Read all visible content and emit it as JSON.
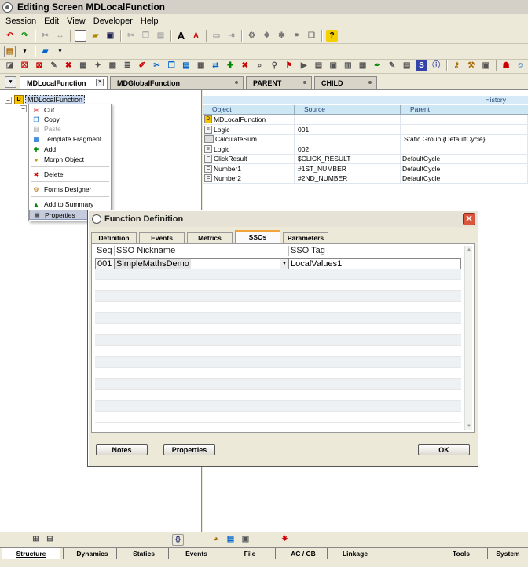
{
  "window": {
    "title": "Editing Screen MDLocalFunction"
  },
  "menu": [
    "Session",
    "Edit",
    "View",
    "Developer",
    "Help"
  ],
  "file_tabs": [
    "MDLocalFunction",
    "MDGlobalFunction",
    "PARENT",
    "CHILD"
  ],
  "tree": {
    "root": "MDLocalFunction"
  },
  "context_menu": {
    "cut": "Cut",
    "copy": "Copy",
    "paste": "Paste",
    "template_fragment": "Template Fragment",
    "add": "Add",
    "morph_object": "Morph Object",
    "delete": "Delete",
    "forms_designer": "Forms Designer",
    "add_to_summary": "Add to Summary",
    "properties": "Properties"
  },
  "grid": {
    "history": "History",
    "columns": [
      "Object",
      "Source",
      "Parent"
    ],
    "rows": [
      {
        "object": "MDLocalFunction",
        "source": "",
        "parent": ""
      },
      {
        "object": "Logic",
        "source": "001",
        "parent": ""
      },
      {
        "object": "CalculateSum",
        "source": "",
        "parent": "Static Group {DefaultCycle}"
      },
      {
        "object": "Logic",
        "source": "002",
        "parent": ""
      },
      {
        "object": "ClickResult",
        "source": "$CLICK_RESULT",
        "parent": "DefaultCycle"
      },
      {
        "object": "Number1",
        "source": "#1ST_NUMBER",
        "parent": "DefaultCycle"
      },
      {
        "object": "Number2",
        "source": "#2ND_NUMBER",
        "parent": "DefaultCycle"
      }
    ]
  },
  "dialog": {
    "title": "Function Definition",
    "tabs": [
      "Definition",
      "Events",
      "Metrics",
      "SSOs",
      "Parameters"
    ],
    "columns": [
      "Seq",
      "SSO Nickname",
      "SSO Tag"
    ],
    "row": {
      "seq": "001",
      "nickname": "SimpleMathsDemo",
      "tag": "LocalValues1"
    },
    "buttons": {
      "notes": "Notes",
      "properties": "Properties",
      "ok": "OK"
    }
  },
  "bottom_tabs": [
    "Structure",
    "Dynamics",
    "Statics",
    "Events",
    "File",
    "AC / CB",
    "Linkage",
    "Tools",
    "System"
  ],
  "colors": {
    "accent": "#f3a43a",
    "close": "#d9553b",
    "history_bg": "#d6ebf7"
  }
}
